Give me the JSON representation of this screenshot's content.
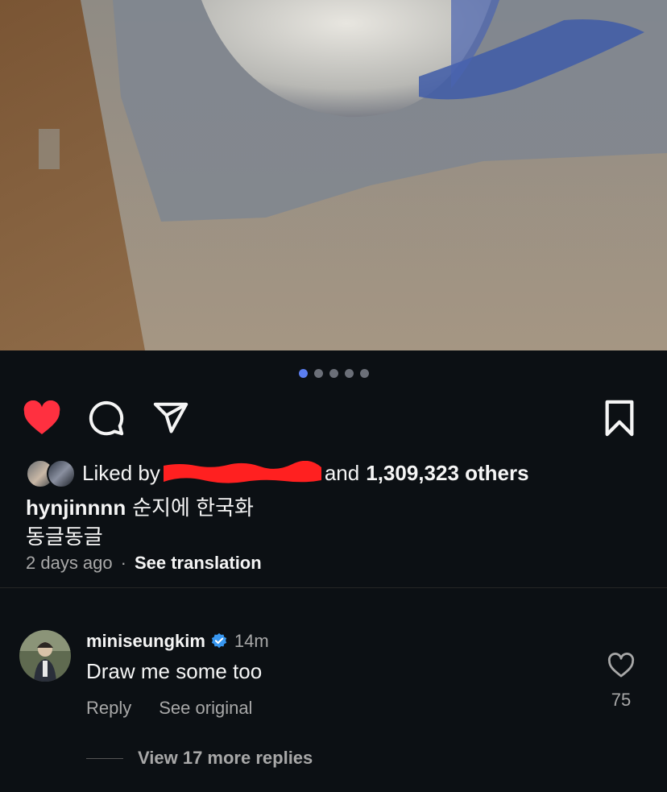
{
  "post": {
    "carousel": {
      "count": 5,
      "active_index": 0
    },
    "icons": [
      "heart-filled-icon",
      "comment-icon",
      "share-icon",
      "bookmark-icon"
    ],
    "colors": {
      "like_red": "#ff3040",
      "active_dot": "#5b7ef0",
      "verified_blue": "#3897f0"
    },
    "likes": {
      "prefix": "Liked by",
      "suffix_and": "and",
      "count": "1,309,323 others"
    },
    "caption": {
      "username": "hynjinnnn",
      "line1": "순지에 한국화",
      "line2": "동글동글"
    },
    "time": "2 days ago",
    "separator": "·",
    "see_translation": "See translation"
  },
  "comment": {
    "username": "miniseungkim",
    "time": "14m",
    "text": "Draw me some too",
    "reply_label": "Reply",
    "see_original_label": "See original",
    "like_count": "75",
    "view_replies": "View 17 more replies"
  }
}
